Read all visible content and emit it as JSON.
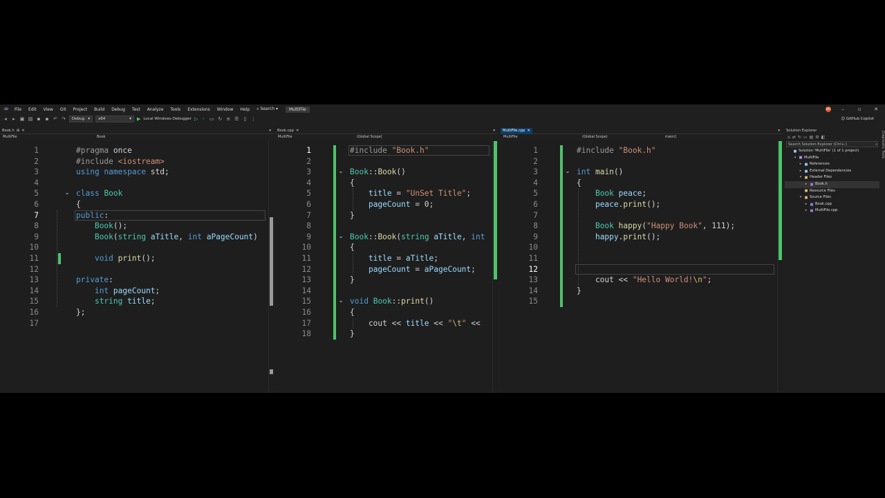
{
  "menu": [
    "File",
    "Edit",
    "View",
    "Git",
    "Project",
    "Build",
    "Debug",
    "Test",
    "Analyze",
    "Tools",
    "Extensions",
    "Window",
    "Help"
  ],
  "search_label": "Search",
  "solution_name": "MultiFile",
  "avatar_initials": "NO",
  "toolbar": {
    "config": "Debug",
    "platform": "x64",
    "debugger": "Local Windows Debugger",
    "copilot": "GitHub Copilot"
  },
  "panes": [
    {
      "tab": "Book.h",
      "project": "MultiFile",
      "scope": "Book",
      "current_line": 7,
      "lines": [
        "#pragma once",
        "#include <iostream>",
        "using namespace std;",
        "",
        "class Book",
        "{",
        "public:",
        "    Book();",
        "    Book(string aTitle, int aPageCount)",
        "",
        "    void print();",
        "",
        "private:",
        "    int pageCount;",
        "    string title;",
        "};",
        ""
      ]
    },
    {
      "tab": "Book.cpp",
      "project": "MultiFile",
      "scope": "(Global Scope)",
      "current_line": 1,
      "lines": [
        "#include \"Book.h\"",
        "",
        "Book::Book()",
        "{",
        "    title = \"UnSet Title\";",
        "    pageCount = 0;",
        "}",
        "",
        "Book::Book(string aTitle, int",
        "{",
        "    title = aTitle;",
        "    pageCount = aPageCount;",
        "}",
        "",
        "void Book::print()",
        "{",
        "    cout << title << \"\\t\" <<",
        "}"
      ]
    },
    {
      "tab": "MultiFile.cpp",
      "project": "MultiFile",
      "scope": "(Global Scope)",
      "member": "main()",
      "current_line": 12,
      "lines": [
        "#include \"Book.h\"",
        "",
        "int main()",
        "{",
        "    Book peace;",
        "    peace.print();",
        "",
        "    Book happy(\"Happy Book\", 111);",
        "    happy.print();",
        "",
        "",
        "",
        "    cout << \"Hello World!\\n\";",
        "}",
        ""
      ]
    }
  ],
  "solution_explorer": {
    "title": "Solution Explorer",
    "search_placeholder": "Search Solution Explorer (Ctrl+;)",
    "nodes": [
      {
        "label": "Solution 'MultiFile' (1 of 1 project)",
        "depth": 0,
        "twisty": "",
        "icon": "solution-icon"
      },
      {
        "label": "MultiFile",
        "depth": 1,
        "twisty": "▾",
        "icon": "project-icon"
      },
      {
        "label": "References",
        "depth": 2,
        "twisty": "▸",
        "icon": "references-icon"
      },
      {
        "label": "External Dependencies",
        "depth": 2,
        "twisty": "▸",
        "icon": "dependencies-icon"
      },
      {
        "label": "Header Files",
        "depth": 2,
        "twisty": "▾",
        "icon": "folder-icon"
      },
      {
        "label": "Book.h",
        "depth": 3,
        "twisty": "▸",
        "icon": "header-file-icon",
        "selected": true
      },
      {
        "label": "Resource Files",
        "depth": 2,
        "twisty": "",
        "icon": "folder-icon"
      },
      {
        "label": "Source Files",
        "depth": 2,
        "twisty": "▾",
        "icon": "folder-icon"
      },
      {
        "label": "Book.cpp",
        "depth": 3,
        "twisty": "▸",
        "icon": "cpp-file-icon"
      },
      {
        "label": "MultiFile.cpp",
        "depth": 3,
        "twisty": "▸",
        "icon": "cpp-file-icon"
      }
    ]
  },
  "side_panel": "Diagnostic Tools",
  "colors": {
    "accent": "#4ec36b",
    "keyword": "#569cd6",
    "type": "#4ec9b0",
    "string": "#ce9178",
    "function": "#dcdcaa",
    "variable": "#9cdcfe"
  }
}
